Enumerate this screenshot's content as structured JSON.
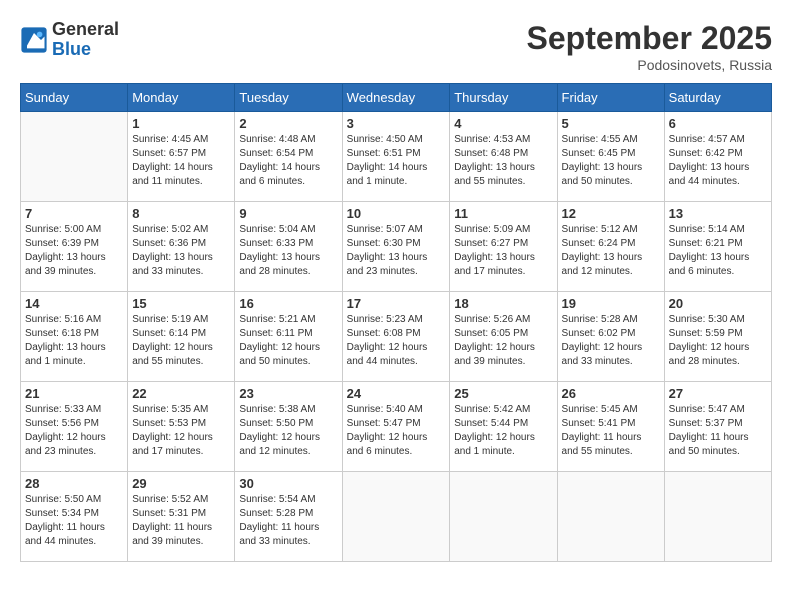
{
  "logo": {
    "general": "General",
    "blue": "Blue"
  },
  "title": {
    "month": "September 2025",
    "location": "Podosinovets, Russia"
  },
  "weekdays": [
    "Sunday",
    "Monday",
    "Tuesday",
    "Wednesday",
    "Thursday",
    "Friday",
    "Saturday"
  ],
  "weeks": [
    [
      {
        "day": "",
        "info": ""
      },
      {
        "day": "1",
        "info": "Sunrise: 4:45 AM\nSunset: 6:57 PM\nDaylight: 14 hours\nand 11 minutes."
      },
      {
        "day": "2",
        "info": "Sunrise: 4:48 AM\nSunset: 6:54 PM\nDaylight: 14 hours\nand 6 minutes."
      },
      {
        "day": "3",
        "info": "Sunrise: 4:50 AM\nSunset: 6:51 PM\nDaylight: 14 hours\nand 1 minute."
      },
      {
        "day": "4",
        "info": "Sunrise: 4:53 AM\nSunset: 6:48 PM\nDaylight: 13 hours\nand 55 minutes."
      },
      {
        "day": "5",
        "info": "Sunrise: 4:55 AM\nSunset: 6:45 PM\nDaylight: 13 hours\nand 50 minutes."
      },
      {
        "day": "6",
        "info": "Sunrise: 4:57 AM\nSunset: 6:42 PM\nDaylight: 13 hours\nand 44 minutes."
      }
    ],
    [
      {
        "day": "7",
        "info": "Sunrise: 5:00 AM\nSunset: 6:39 PM\nDaylight: 13 hours\nand 39 minutes."
      },
      {
        "day": "8",
        "info": "Sunrise: 5:02 AM\nSunset: 6:36 PM\nDaylight: 13 hours\nand 33 minutes."
      },
      {
        "day": "9",
        "info": "Sunrise: 5:04 AM\nSunset: 6:33 PM\nDaylight: 13 hours\nand 28 minutes."
      },
      {
        "day": "10",
        "info": "Sunrise: 5:07 AM\nSunset: 6:30 PM\nDaylight: 13 hours\nand 23 minutes."
      },
      {
        "day": "11",
        "info": "Sunrise: 5:09 AM\nSunset: 6:27 PM\nDaylight: 13 hours\nand 17 minutes."
      },
      {
        "day": "12",
        "info": "Sunrise: 5:12 AM\nSunset: 6:24 PM\nDaylight: 13 hours\nand 12 minutes."
      },
      {
        "day": "13",
        "info": "Sunrise: 5:14 AM\nSunset: 6:21 PM\nDaylight: 13 hours\nand 6 minutes."
      }
    ],
    [
      {
        "day": "14",
        "info": "Sunrise: 5:16 AM\nSunset: 6:18 PM\nDaylight: 13 hours\nand 1 minute."
      },
      {
        "day": "15",
        "info": "Sunrise: 5:19 AM\nSunset: 6:14 PM\nDaylight: 12 hours\nand 55 minutes."
      },
      {
        "day": "16",
        "info": "Sunrise: 5:21 AM\nSunset: 6:11 PM\nDaylight: 12 hours\nand 50 minutes."
      },
      {
        "day": "17",
        "info": "Sunrise: 5:23 AM\nSunset: 6:08 PM\nDaylight: 12 hours\nand 44 minutes."
      },
      {
        "day": "18",
        "info": "Sunrise: 5:26 AM\nSunset: 6:05 PM\nDaylight: 12 hours\nand 39 minutes."
      },
      {
        "day": "19",
        "info": "Sunrise: 5:28 AM\nSunset: 6:02 PM\nDaylight: 12 hours\nand 33 minutes."
      },
      {
        "day": "20",
        "info": "Sunrise: 5:30 AM\nSunset: 5:59 PM\nDaylight: 12 hours\nand 28 minutes."
      }
    ],
    [
      {
        "day": "21",
        "info": "Sunrise: 5:33 AM\nSunset: 5:56 PM\nDaylight: 12 hours\nand 23 minutes."
      },
      {
        "day": "22",
        "info": "Sunrise: 5:35 AM\nSunset: 5:53 PM\nDaylight: 12 hours\nand 17 minutes."
      },
      {
        "day": "23",
        "info": "Sunrise: 5:38 AM\nSunset: 5:50 PM\nDaylight: 12 hours\nand 12 minutes."
      },
      {
        "day": "24",
        "info": "Sunrise: 5:40 AM\nSunset: 5:47 PM\nDaylight: 12 hours\nand 6 minutes."
      },
      {
        "day": "25",
        "info": "Sunrise: 5:42 AM\nSunset: 5:44 PM\nDaylight: 12 hours\nand 1 minute."
      },
      {
        "day": "26",
        "info": "Sunrise: 5:45 AM\nSunset: 5:41 PM\nDaylight: 11 hours\nand 55 minutes."
      },
      {
        "day": "27",
        "info": "Sunrise: 5:47 AM\nSunset: 5:37 PM\nDaylight: 11 hours\nand 50 minutes."
      }
    ],
    [
      {
        "day": "28",
        "info": "Sunrise: 5:50 AM\nSunset: 5:34 PM\nDaylight: 11 hours\nand 44 minutes."
      },
      {
        "day": "29",
        "info": "Sunrise: 5:52 AM\nSunset: 5:31 PM\nDaylight: 11 hours\nand 39 minutes."
      },
      {
        "day": "30",
        "info": "Sunrise: 5:54 AM\nSunset: 5:28 PM\nDaylight: 11 hours\nand 33 minutes."
      },
      {
        "day": "",
        "info": ""
      },
      {
        "day": "",
        "info": ""
      },
      {
        "day": "",
        "info": ""
      },
      {
        "day": "",
        "info": ""
      }
    ]
  ]
}
